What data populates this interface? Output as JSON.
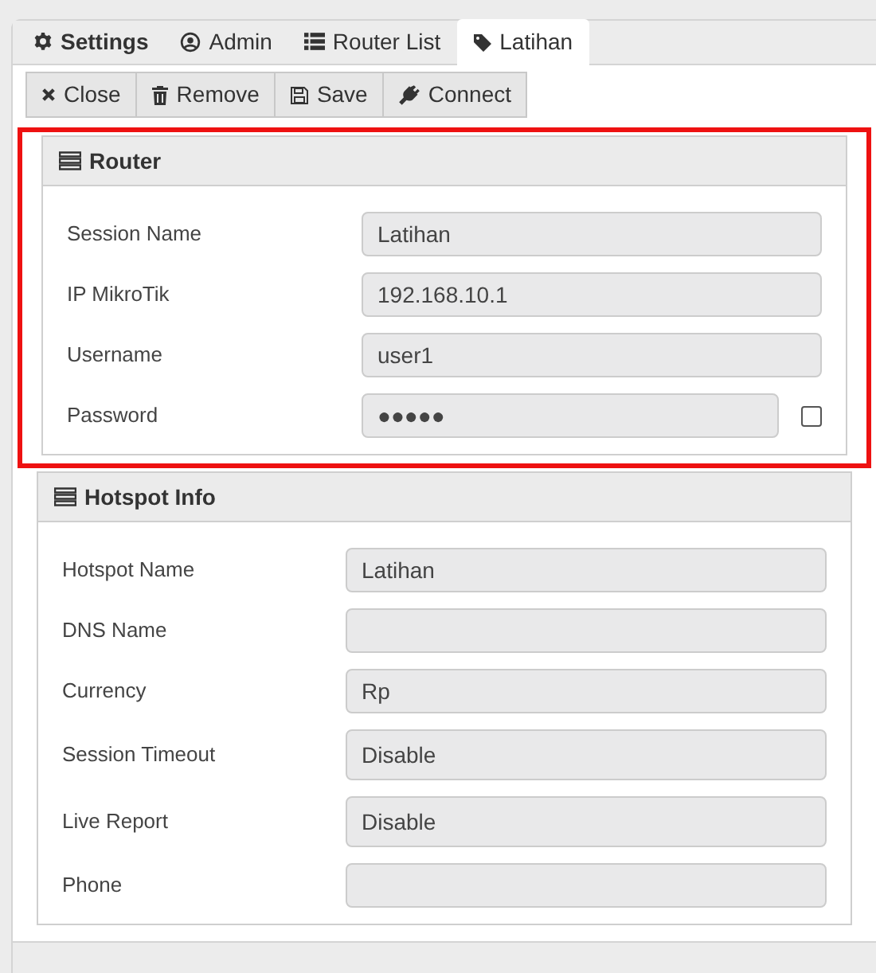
{
  "tabs": [
    {
      "label": "Settings",
      "selected": false
    },
    {
      "label": "Admin",
      "selected": false
    },
    {
      "label": "Router List",
      "selected": false
    },
    {
      "label": "Latihan",
      "selected": true
    }
  ],
  "toolbar": [
    {
      "label": "Close"
    },
    {
      "label": "Remove"
    },
    {
      "label": "Save"
    },
    {
      "label": "Connect"
    }
  ],
  "panels": [
    {
      "title": "Router",
      "highlighted": true,
      "fields": [
        {
          "kind": "text",
          "label": "Session Name",
          "value": "Latihan"
        },
        {
          "kind": "text",
          "label": "IP MikroTik",
          "value": "192.168.10.1"
        },
        {
          "kind": "text",
          "label": "Username",
          "value": "user1"
        },
        {
          "kind": "password",
          "label": "Password",
          "value": "●●●●●",
          "checked": false
        }
      ]
    },
    {
      "title": "Hotspot Info",
      "highlighted": false,
      "fields": [
        {
          "kind": "text",
          "label": "Hotspot Name",
          "value": "Latihan"
        },
        {
          "kind": "text",
          "label": "DNS Name"
        },
        {
          "kind": "text",
          "label": "Currency",
          "value": "Rp"
        },
        {
          "kind": "select",
          "label": "Session Timeout",
          "value": "Disable"
        },
        {
          "kind": "select",
          "label": "Live Report",
          "value": "Disable"
        },
        {
          "kind": "text",
          "label": "Phone"
        }
      ]
    }
  ]
}
